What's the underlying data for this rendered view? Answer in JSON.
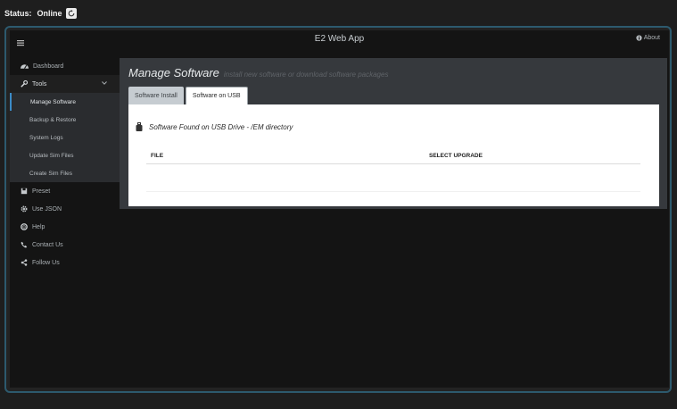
{
  "status": {
    "label": "Status:",
    "value": "Online"
  },
  "header": {
    "title": "E2 Web App",
    "about": "About"
  },
  "sidebar": {
    "items": [
      {
        "label": "Dashboard"
      },
      {
        "label": "Tools"
      },
      {
        "label": "Preset"
      },
      {
        "label": "Use JSON"
      },
      {
        "label": "Help"
      },
      {
        "label": "Contact Us"
      },
      {
        "label": "Follow Us"
      }
    ],
    "tools_sub": [
      {
        "label": "Manage Software"
      },
      {
        "label": "Backup & Restore"
      },
      {
        "label": "System Logs"
      },
      {
        "label": "Update Sim Files"
      },
      {
        "label": "Create Sim Files"
      }
    ]
  },
  "main": {
    "title": "Manage Software",
    "subtitle": "install new software or download software packages",
    "tabs": [
      {
        "label": "Software Install"
      },
      {
        "label": "Software on USB"
      }
    ],
    "panel": {
      "heading": "Software Found on USB Drive - /EM directory",
      "columns": [
        "FILE",
        "SELECT UPGRADE"
      ]
    }
  },
  "colors": {
    "accent": "#3b8bc7",
    "frame": "#2d5a6e"
  }
}
